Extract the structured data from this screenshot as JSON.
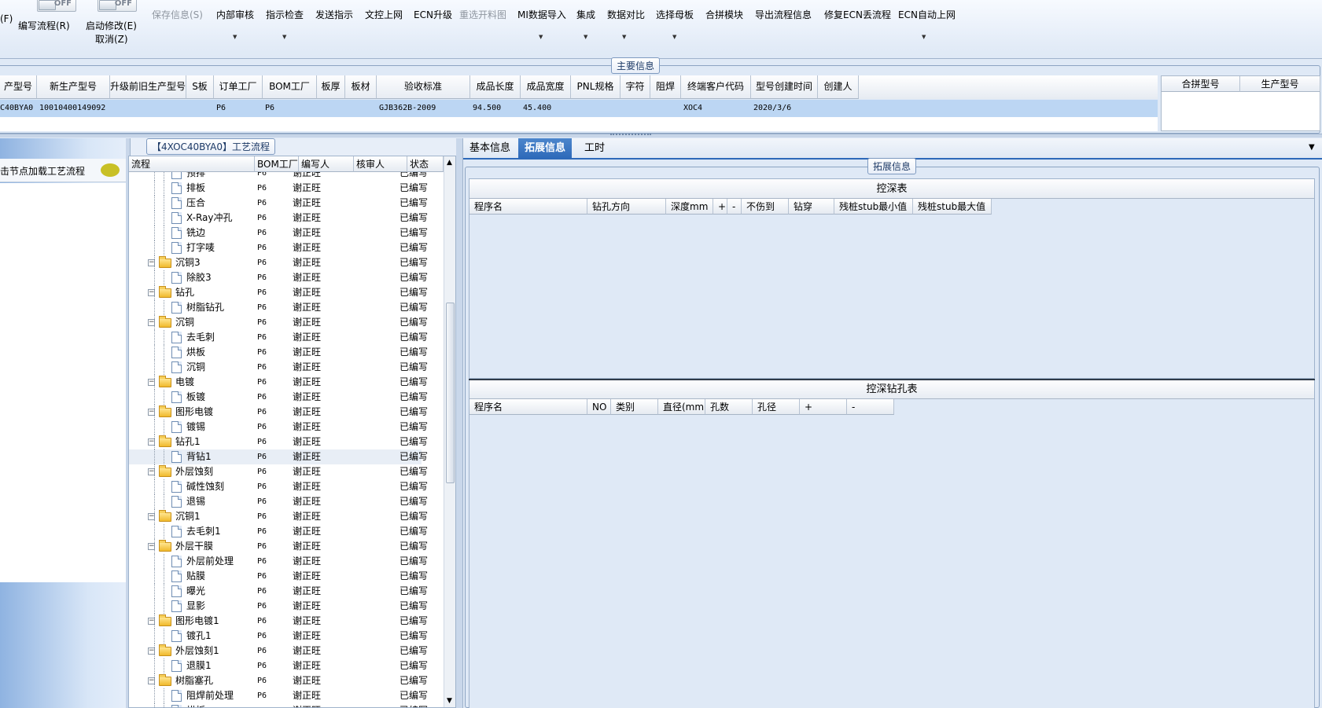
{
  "toolbar": {
    "f_label": "(F)",
    "toggle1_state": "OFF",
    "toggle2_state": "OFF",
    "write_flow": "编写流程(R)",
    "start_modify": "启动修改(E)",
    "cancel": "取消(Z)",
    "save_info": "保存信息(S)",
    "internal_review": "内部审核",
    "indicator_check": "指示检查",
    "send_indicator": "发送指示",
    "doc_upload": "文控上网",
    "ecn_upgrade": "ECN升级",
    "reselect_chart": "重选开料图",
    "mi_import": "MI数据导入",
    "integrate": "集成",
    "data_compare": "数据对比",
    "select_master": "选择母板",
    "merge_module": "合拼模块",
    "export_flow": "导出流程信息",
    "repair_ecn": "修复ECN丢流程",
    "ecn_auto": "ECN自动上网"
  },
  "main_info": {
    "caption": "主要信息",
    "columns": [
      "产型号",
      "新生产型号",
      "升级前旧生产型号",
      "S板",
      "订单工厂",
      "BOM工厂",
      "板厚",
      "板材",
      "验收标准",
      "成品长度",
      "成品宽度",
      "PNL规格",
      "字符",
      "阻焊",
      "终端客户代码",
      "型号创建时间",
      "创建人"
    ],
    "row": [
      "C40BYA0",
      "10010400149092",
      "",
      "",
      "P6",
      "P6",
      "",
      "",
      "GJB362B-2009",
      "94.500",
      "45.400",
      "",
      "",
      "",
      "XOC4",
      "2020/3/6",
      ""
    ],
    "right_columns": [
      "合拼型号",
      "生产型号"
    ]
  },
  "left_panel": {
    "load_hint": "击节点加载工艺流程"
  },
  "flow": {
    "caption": "【4XOC40BYA0】工艺流程",
    "columns": [
      "流程",
      "BOM工厂",
      "编写人",
      "核审人",
      "状态"
    ],
    "rows": [
      {
        "name": "预排",
        "type": "doc",
        "bom": "P6",
        "writer": "谢正旺",
        "reviewer": "",
        "status": "已编写"
      },
      {
        "name": "排板",
        "type": "doc",
        "bom": "P6",
        "writer": "谢正旺",
        "reviewer": "",
        "status": "已编写"
      },
      {
        "name": "压合",
        "type": "doc",
        "bom": "P6",
        "writer": "谢正旺",
        "reviewer": "",
        "status": "已编写"
      },
      {
        "name": "X-Ray冲孔",
        "type": "doc",
        "bom": "P6",
        "writer": "谢正旺",
        "reviewer": "",
        "status": "已编写"
      },
      {
        "name": "铣边",
        "type": "doc",
        "bom": "P6",
        "writer": "谢正旺",
        "reviewer": "",
        "status": "已编写"
      },
      {
        "name": "打字唛",
        "type": "doc",
        "bom": "P6",
        "writer": "谢正旺",
        "reviewer": "",
        "status": "已编写"
      },
      {
        "name": "沉铜3",
        "type": "fold",
        "bom": "P6",
        "writer": "谢正旺",
        "reviewer": "",
        "status": "已编写"
      },
      {
        "name": "除胶3",
        "type": "doc",
        "bom": "P6",
        "writer": "谢正旺",
        "reviewer": "",
        "status": "已编写"
      },
      {
        "name": "钻孔",
        "type": "fold",
        "bom": "P6",
        "writer": "谢正旺",
        "reviewer": "",
        "status": "已编写"
      },
      {
        "name": "树脂钻孔",
        "type": "doc",
        "bom": "P6",
        "writer": "谢正旺",
        "reviewer": "",
        "status": "已编写"
      },
      {
        "name": "沉铜",
        "type": "fold",
        "bom": "P6",
        "writer": "谢正旺",
        "reviewer": "",
        "status": "已编写"
      },
      {
        "name": "去毛刺",
        "type": "doc",
        "bom": "P6",
        "writer": "谢正旺",
        "reviewer": "",
        "status": "已编写"
      },
      {
        "name": "烘板",
        "type": "doc",
        "bom": "P6",
        "writer": "谢正旺",
        "reviewer": "",
        "status": "已编写"
      },
      {
        "name": "沉铜",
        "type": "doc",
        "bom": "P6",
        "writer": "谢正旺",
        "reviewer": "",
        "status": "已编写"
      },
      {
        "name": "电镀",
        "type": "fold",
        "bom": "P6",
        "writer": "谢正旺",
        "reviewer": "",
        "status": "已编写"
      },
      {
        "name": "板镀",
        "type": "doc",
        "bom": "P6",
        "writer": "谢正旺",
        "reviewer": "",
        "status": "已编写"
      },
      {
        "name": "图形电镀",
        "type": "fold",
        "bom": "P6",
        "writer": "谢正旺",
        "reviewer": "",
        "status": "已编写"
      },
      {
        "name": "镀锡",
        "type": "doc",
        "bom": "P6",
        "writer": "谢正旺",
        "reviewer": "",
        "status": "已编写"
      },
      {
        "name": "钻孔1",
        "type": "fold",
        "bom": "P6",
        "writer": "谢正旺",
        "reviewer": "",
        "status": "已编写"
      },
      {
        "name": "背钻1",
        "type": "doc",
        "bom": "P6",
        "writer": "谢正旺",
        "reviewer": "",
        "status": "已编写"
      },
      {
        "name": "外层蚀刻",
        "type": "fold",
        "bom": "P6",
        "writer": "谢正旺",
        "reviewer": "",
        "status": "已编写"
      },
      {
        "name": "碱性蚀刻",
        "type": "doc",
        "bom": "P6",
        "writer": "谢正旺",
        "reviewer": "",
        "status": "已编写"
      },
      {
        "name": "退锡",
        "type": "doc",
        "bom": "P6",
        "writer": "谢正旺",
        "reviewer": "",
        "status": "已编写"
      },
      {
        "name": "沉铜1",
        "type": "fold",
        "bom": "P6",
        "writer": "谢正旺",
        "reviewer": "",
        "status": "已编写"
      },
      {
        "name": "去毛刺1",
        "type": "doc",
        "bom": "P6",
        "writer": "谢正旺",
        "reviewer": "",
        "status": "已编写"
      },
      {
        "name": "外层干膜",
        "type": "fold",
        "bom": "P6",
        "writer": "谢正旺",
        "reviewer": "",
        "status": "已编写"
      },
      {
        "name": "外层前处理",
        "type": "doc",
        "bom": "P6",
        "writer": "谢正旺",
        "reviewer": "",
        "status": "已编写"
      },
      {
        "name": "贴膜",
        "type": "doc",
        "bom": "P6",
        "writer": "谢正旺",
        "reviewer": "",
        "status": "已编写"
      },
      {
        "name": "曝光",
        "type": "doc",
        "bom": "P6",
        "writer": "谢正旺",
        "reviewer": "",
        "status": "已编写"
      },
      {
        "name": "显影",
        "type": "doc",
        "bom": "P6",
        "writer": "谢正旺",
        "reviewer": "",
        "status": "已编写"
      },
      {
        "name": "图形电镀1",
        "type": "fold",
        "bom": "P6",
        "writer": "谢正旺",
        "reviewer": "",
        "status": "已编写"
      },
      {
        "name": "镀孔1",
        "type": "doc",
        "bom": "P6",
        "writer": "谢正旺",
        "reviewer": "",
        "status": "已编写"
      },
      {
        "name": "外层蚀刻1",
        "type": "fold",
        "bom": "P6",
        "writer": "谢正旺",
        "reviewer": "",
        "status": "已编写"
      },
      {
        "name": "退膜1",
        "type": "doc",
        "bom": "P6",
        "writer": "谢正旺",
        "reviewer": "",
        "status": "已编写"
      },
      {
        "name": "树脂塞孔",
        "type": "fold",
        "bom": "P6",
        "writer": "谢正旺",
        "reviewer": "",
        "status": "已编写"
      },
      {
        "name": "阻焊前处理",
        "type": "doc",
        "bom": "P6",
        "writer": "谢正旺",
        "reviewer": "",
        "status": "已编写"
      },
      {
        "name": "烘板",
        "type": "doc",
        "bom": "P6",
        "writer": "谢正旺",
        "reviewer": "",
        "status": "已编写"
      }
    ]
  },
  "tabs": [
    "基本信息",
    "拓展信息",
    "工时"
  ],
  "ext": {
    "caption": "拓展信息",
    "depth_table": {
      "title": "控深表",
      "columns": [
        "程序名",
        "钻孔方向",
        "深度mm",
        "+",
        "-",
        "不伤到",
        "钻穿",
        "残桩stub最小值",
        "残桩stub最大值"
      ]
    },
    "hole_table": {
      "title": "控深钻孔表",
      "columns": [
        "程序名",
        "NO",
        "类别",
        "直径(mm)",
        "孔数",
        "孔径",
        "+",
        "-"
      ]
    }
  },
  "colors": {
    "accent": "#2d69b9",
    "panel_bg": "#dfe9f6",
    "selected_row": "#bcd6f3"
  }
}
